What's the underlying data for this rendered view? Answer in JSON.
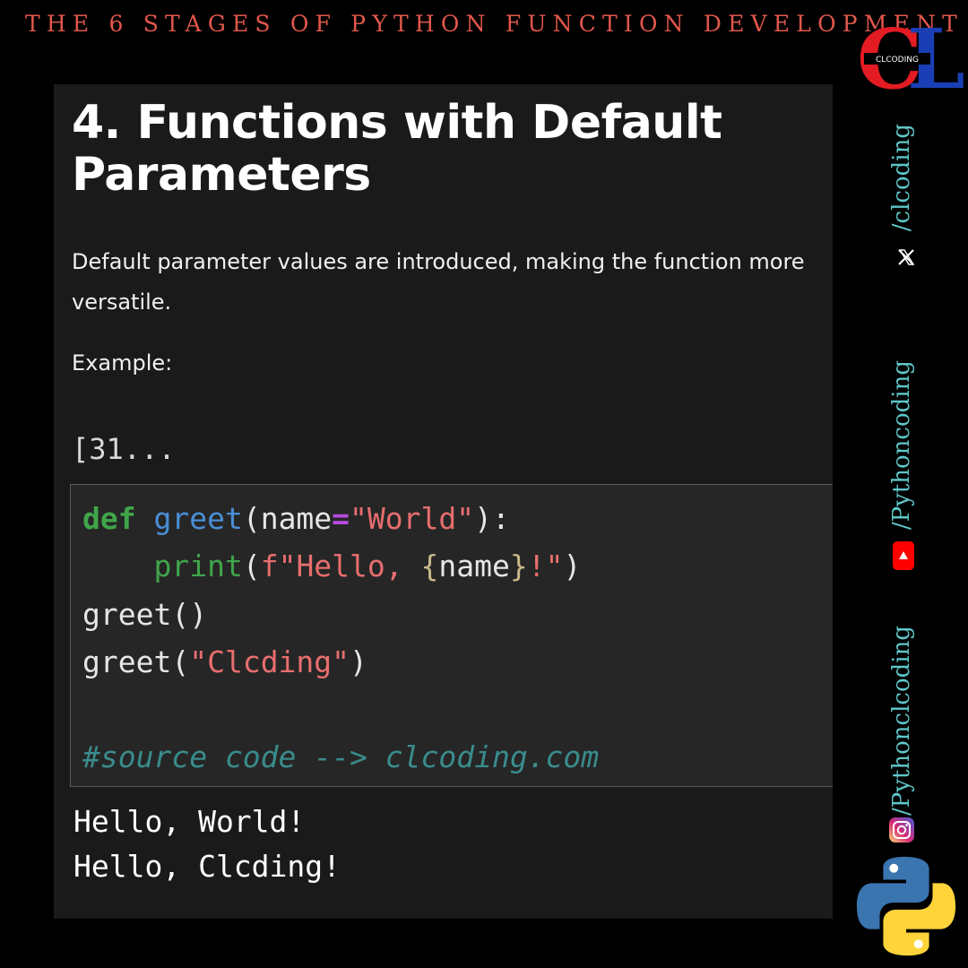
{
  "header": {
    "title": "THE 6 STAGES OF PYTHON FUNCTION DEVELOPMENT"
  },
  "logo": {
    "letters": "CL",
    "sub": "CLCODING"
  },
  "content": {
    "title": "4. Functions with Default Parameters",
    "description": "Default parameter values are introduced, making the function more versatile.",
    "example_label": "Example:",
    "cell_prompt": "[31..."
  },
  "code": {
    "line1": {
      "kw": "def",
      "fn": "greet",
      "open": "(name",
      "eq": "=",
      "str": "\"World\"",
      "close": "):"
    },
    "line2": {
      "indent": "    ",
      "bi": "print",
      "open": "(",
      "str1": "f\"Hello, ",
      "b1": "{",
      "var": "name",
      "b2": "}",
      "str2": "!\"",
      "close": ")"
    },
    "line3": "greet()",
    "line4": {
      "pre": "greet(",
      "str": "\"Clcding\"",
      "close": ")"
    },
    "comment": "#source code --> clcoding.com"
  },
  "output": {
    "line1": "Hello, World!",
    "line2": "Hello, Clcding!"
  },
  "social": {
    "handle_x": "/clcoding",
    "handle_youtube": "/Pythoncoding",
    "handle_instagram": "/Pythonclcoding",
    "icons": [
      "x-icon",
      "youtube-icon",
      "instagram-icon",
      "python-logo-icon"
    ]
  },
  "colors": {
    "header": "#e2574c",
    "handles": "#5fc7c9",
    "keyword": "#3fa54a",
    "function": "#4a8fd6",
    "string": "#e86e6e",
    "comment": "#3a8c8c"
  }
}
